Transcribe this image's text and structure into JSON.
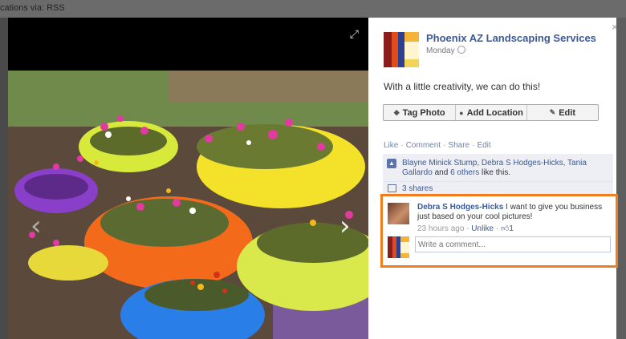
{
  "background": {
    "top_text": "cations via: RSS"
  },
  "photo": {
    "alt": "Painted tire planters with flowers"
  },
  "post": {
    "page_name": "Phoenix AZ Landscaping Services",
    "time": "Monday",
    "caption": "With a little creativity, we can do this!"
  },
  "toolbar": {
    "tag_label": "Tag Photo",
    "location_label": "Add Location",
    "edit_label": "Edit"
  },
  "actions": {
    "like": "Like",
    "comment": "Comment",
    "share": "Share",
    "edit": "Edit"
  },
  "likes": {
    "names": "Blayne Minick Stump, Debra S Hodges-Hicks, Tania Gallardo",
    "and": "and",
    "others": "6 others",
    "suffix": "like this."
  },
  "shares": {
    "label": "3 shares"
  },
  "comment": {
    "author": "Debra S Hodges-Hicks",
    "text": "I want to give you business just based on your cool pictures!",
    "time": "23 hours ago",
    "unlike": "Unlike",
    "like_count": "1"
  },
  "reply": {
    "placeholder": "Write a comment..."
  },
  "colors": {
    "accent": "#3b5998",
    "highlight": "#f07d1d"
  }
}
